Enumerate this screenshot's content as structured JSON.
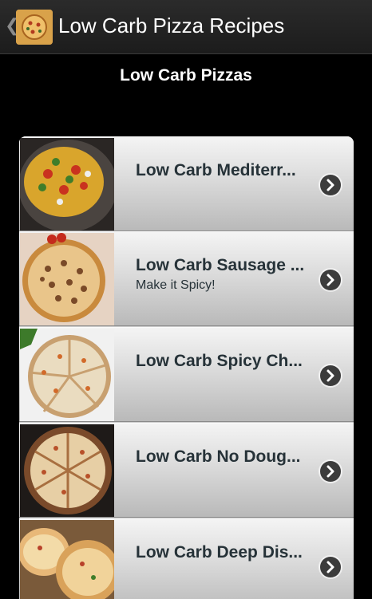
{
  "actionbar": {
    "title": "Low Carb Pizza Recipes",
    "back_icon": "chevron-left-icon",
    "app_icon": "pizza-icon"
  },
  "page": {
    "heading": "Low Carb Pizzas"
  },
  "recipes": [
    {
      "title": "Low Carb Mediterr...",
      "subtitle": ""
    },
    {
      "title": "Low Carb Sausage ...",
      "subtitle": "Make it Spicy!"
    },
    {
      "title": "Low Carb Spicy Ch...",
      "subtitle": ""
    },
    {
      "title": "Low Carb No Doug...",
      "subtitle": ""
    },
    {
      "title": "Low Carb Deep Dis...",
      "subtitle": ""
    }
  ],
  "colors": {
    "accent_text": "#263238",
    "background": "#000000"
  }
}
